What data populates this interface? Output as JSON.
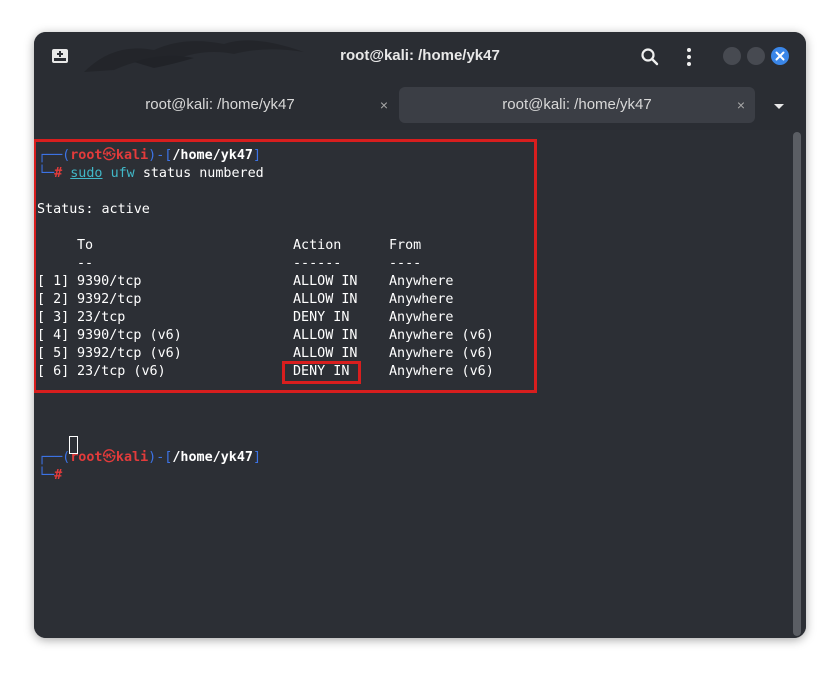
{
  "window": {
    "title": "root@kali: /home/yk47"
  },
  "tabs": [
    {
      "label": "root@kali: /home/yk47",
      "close": "×"
    },
    {
      "label": "root@kali: /home/yk47",
      "close": "×"
    }
  ],
  "prompt": {
    "user": "root",
    "symbol": "㉿",
    "host": "kali",
    "path": "/home/yk47",
    "hash": "#"
  },
  "command": {
    "cmd1": "sudo",
    "cmd2": "ufw",
    "args": "status numbered"
  },
  "output": {
    "status": "Status: active",
    "headers": {
      "to": "To",
      "action": "Action",
      "from": "From"
    },
    "dashes": {
      "to": "--",
      "action": "------",
      "from": "----"
    },
    "rules": [
      {
        "num": "[ 1]",
        "to": "9390/tcp",
        "action": "ALLOW IN",
        "from": "Anywhere"
      },
      {
        "num": "[ 2]",
        "to": "9392/tcp",
        "action": "ALLOW IN",
        "from": "Anywhere"
      },
      {
        "num": "[ 3]",
        "to": "23/tcp",
        "action": "DENY IN",
        "from": "Anywhere"
      },
      {
        "num": "[ 4]",
        "to": "9390/tcp (v6)",
        "action": "ALLOW IN",
        "from": "Anywhere (v6)"
      },
      {
        "num": "[ 5]",
        "to": "9392/tcp (v6)",
        "action": "ALLOW IN",
        "from": "Anywhere (v6)"
      },
      {
        "num": "[ 6]",
        "to": "23/tcp (v6)",
        "action": "DENY IN",
        "from": "Anywhere (v6)"
      }
    ]
  },
  "colors": {
    "prompt_frame": "#3c73e6",
    "prompt_user": "#e33b3b",
    "command": "#41b8c8",
    "highlight": "#d81e1e",
    "close_button": "#3a86e8"
  },
  "icons": {
    "new_tab": "new-tab-icon",
    "search": "search-icon",
    "menu": "kebab-menu-icon",
    "dropdown": "chevron-down-icon",
    "close": "close-icon"
  }
}
